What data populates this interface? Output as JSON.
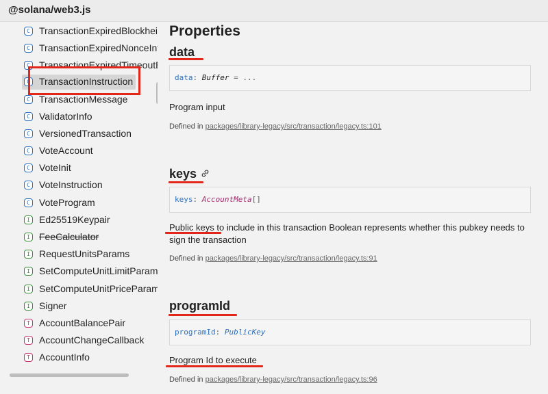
{
  "header": {
    "title": "@solana/web3.js"
  },
  "sidebar": {
    "items": [
      {
        "kind": "C",
        "label": "TransactionExpiredBlockheightExceededError"
      },
      {
        "kind": "C",
        "label": "TransactionExpiredNonceInvalidError"
      },
      {
        "kind": "C",
        "label": "TransactionExpiredTimeoutError"
      },
      {
        "kind": "C",
        "label": "TransactionInstruction"
      },
      {
        "kind": "C",
        "label": "TransactionMessage"
      },
      {
        "kind": "C",
        "label": "ValidatorInfo"
      },
      {
        "kind": "C",
        "label": "VersionedTransaction"
      },
      {
        "kind": "C",
        "label": "VoteAccount"
      },
      {
        "kind": "C",
        "label": "VoteInit"
      },
      {
        "kind": "C",
        "label": "VoteInstruction"
      },
      {
        "kind": "C",
        "label": "VoteProgram"
      },
      {
        "kind": "I",
        "label": "Ed25519Keypair"
      },
      {
        "kind": "I",
        "label": "FeeCalculator"
      },
      {
        "kind": "I",
        "label": "RequestUnitsParams"
      },
      {
        "kind": "I",
        "label": "SetComputeUnitLimitParams"
      },
      {
        "kind": "I",
        "label": "SetComputeUnitPriceParams"
      },
      {
        "kind": "I",
        "label": "Signer"
      },
      {
        "kind": "T",
        "label": "AccountBalancePair"
      },
      {
        "kind": "T",
        "label": "AccountChangeCallback"
      },
      {
        "kind": "T",
        "label": "AccountInfo"
      }
    ]
  },
  "main": {
    "section_title": "Properties",
    "defined_in_label": "Defined in",
    "properties": [
      {
        "name": "data",
        "sig_name": "data",
        "sig_colon": ":",
        "sig_type": "Buffer",
        "sig_default": " = ...",
        "description": "Program input",
        "source": "packages/library-legacy/src/transaction/legacy.ts:101"
      },
      {
        "name": "keys",
        "sig_name": "keys",
        "sig_colon": ":",
        "sig_type": "AccountMeta",
        "sig_suffix": "[]",
        "description": "Public keys to include in this transaction Boolean represents whether this pubkey needs to sign the transaction",
        "source": "packages/library-legacy/src/transaction/legacy.ts:91"
      },
      {
        "name": "programId",
        "sig_name": "programId",
        "sig_colon": ":",
        "sig_type": "PublicKey",
        "description": "Program Id to execute",
        "source": "packages/library-legacy/src/transaction/legacy.ts:96"
      }
    ]
  },
  "colors": {
    "annotation": "#e3261a",
    "class_icon": "#2f6fb7",
    "interface_icon": "#3b8a3b",
    "type_icon": "#c4336d"
  },
  "icons": {
    "class": "C",
    "interface": "I",
    "type_alias": "T",
    "anchor": "link-icon"
  }
}
